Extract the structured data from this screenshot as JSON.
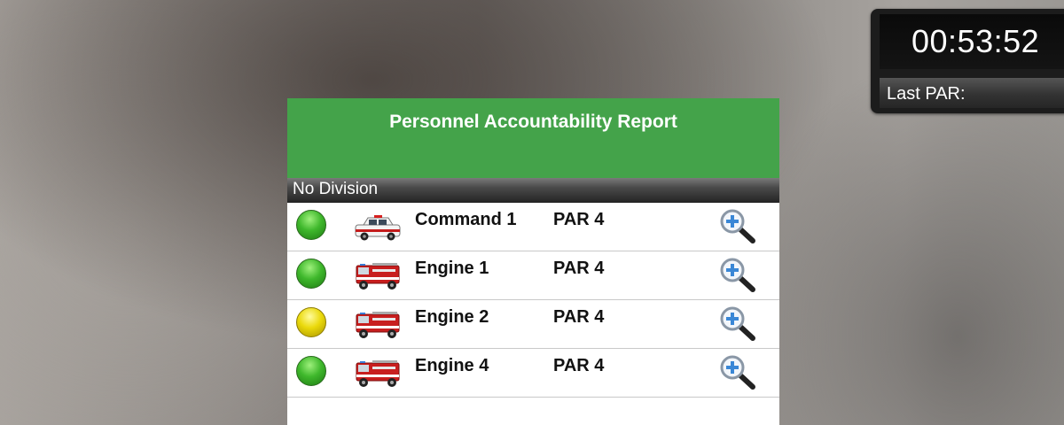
{
  "timer": {
    "elapsed": "00:53:52",
    "last_par_label": "Last PAR:"
  },
  "panel": {
    "title": "Personnel Accountability Report",
    "division": "No Division",
    "units": [
      {
        "name": "Command 1",
        "par": "PAR 4",
        "status": "green",
        "vehicle": "command-suv-icon"
      },
      {
        "name": "Engine 1",
        "par": "PAR 4",
        "status": "green",
        "vehicle": "fire-engine-icon"
      },
      {
        "name": "Engine 2",
        "par": "PAR 4",
        "status": "yellow",
        "vehicle": "fire-engine-icon"
      },
      {
        "name": "Engine 4",
        "par": "PAR 4",
        "status": "green",
        "vehicle": "fire-engine-icon"
      }
    ]
  },
  "colors": {
    "header_green": "#44a34a",
    "status_green": "#3fb82c",
    "status_yellow": "#ead90b"
  }
}
